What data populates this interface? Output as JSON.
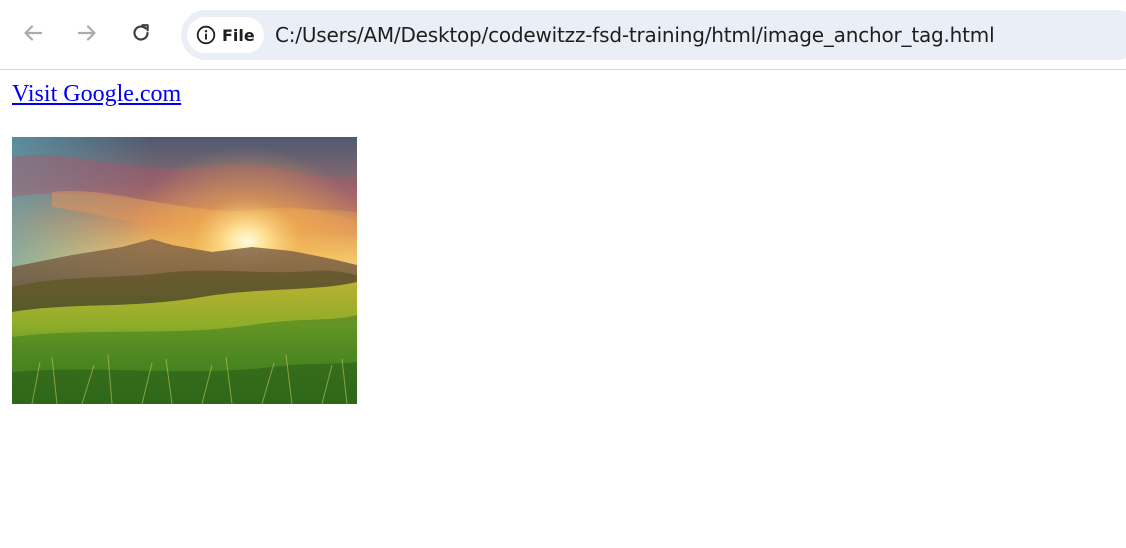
{
  "browser": {
    "site_chip_label": "File",
    "url": "C:/Users/AM/Desktop/codewitzz-fsd-training/html/image_anchor_tag.html",
    "icons": {
      "back": "arrow-left-icon",
      "forward": "arrow-right-icon",
      "reload": "reload-icon",
      "info": "info-icon"
    }
  },
  "page": {
    "link_text": "Visit Google.com",
    "image": {
      "subject": "sunrise-over-grassy-mountains"
    }
  },
  "colors": {
    "link": "#0000ee",
    "omnibox_bg": "#eaeef6",
    "toolbar_border": "#d3d6db"
  }
}
